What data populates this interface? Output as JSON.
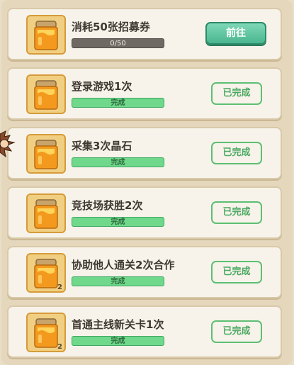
{
  "tasks": [
    {
      "title": "消耗50张招募券",
      "progress_label": "0/50",
      "progress": 0.0,
      "status": "go",
      "button_label": "前往",
      "count": ""
    },
    {
      "title": "登录游戏1次",
      "progress_label": "完成",
      "progress": 1.0,
      "status": "done",
      "button_label": "已完成",
      "count": ""
    },
    {
      "title": "采集3次晶石",
      "progress_label": "完成",
      "progress": 1.0,
      "status": "done",
      "button_label": "已完成",
      "count": ""
    },
    {
      "title": "竞技场获胜2次",
      "progress_label": "完成",
      "progress": 1.0,
      "status": "done",
      "button_label": "已完成",
      "count": ""
    },
    {
      "title": "协助他人通关2次合作",
      "progress_label": "完成",
      "progress": 1.0,
      "status": "done",
      "button_label": "已完成",
      "count": "2"
    },
    {
      "title": "首通主线新关卡1次",
      "progress_label": "完成",
      "progress": 1.0,
      "status": "done",
      "button_label": "已完成",
      "count": "2"
    }
  ],
  "reward_icon": "honey-jar-icon",
  "colors": {
    "done_green": "#6fd88a",
    "go_button": "#49b68f",
    "card_bg": "#f7f3ea"
  }
}
